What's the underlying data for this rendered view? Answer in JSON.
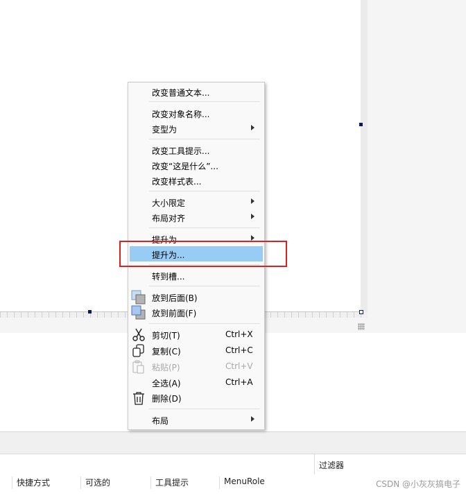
{
  "context_menu": {
    "items": [
      {
        "label": "改变普通文本..."
      },
      {
        "label": "改变对象名称..."
      },
      {
        "label": "变型为"
      },
      {
        "label": "改变工具提示..."
      },
      {
        "label": "改变“这是什么”..."
      },
      {
        "label": "改变样式表..."
      },
      {
        "label": "大小限定"
      },
      {
        "label": "布局对齐"
      },
      {
        "label": "提升为"
      },
      {
        "label": "提升为..."
      },
      {
        "label": "转到槽..."
      },
      {
        "label": "放到后面(B)"
      },
      {
        "label": "放到前面(F)"
      },
      {
        "label": "剪切(T)",
        "shortcut": "Ctrl+X"
      },
      {
        "label": "复制(C)",
        "shortcut": "Ctrl+C"
      },
      {
        "label": "粘贴(P)",
        "shortcut": "Ctrl+V"
      },
      {
        "label": "全选(A)",
        "shortcut": "Ctrl+A"
      },
      {
        "label": "删除(D)"
      },
      {
        "label": "布局"
      }
    ]
  },
  "filter": {
    "label": "过滤器"
  },
  "action_editor": {
    "columns": [
      "快捷方式",
      "可选的",
      "工具提示",
      "MenuRole"
    ]
  },
  "watermark": "CSDN @小灰灰搞电子",
  "colors": {
    "highlight": "#99ccf5",
    "annotation_box": "#dc2020"
  }
}
